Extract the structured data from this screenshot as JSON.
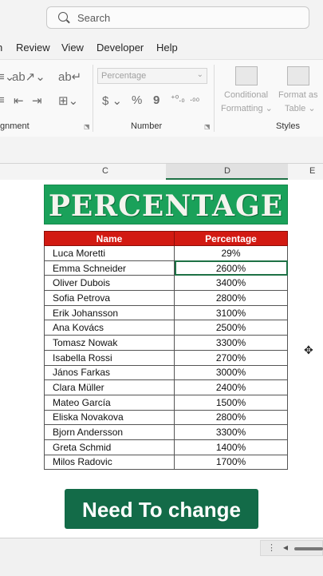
{
  "search": {
    "placeholder": "Search"
  },
  "tabs": [
    {
      "label": "Review"
    },
    {
      "label": "View"
    },
    {
      "label": "Developer"
    },
    {
      "label": "Help"
    }
  ],
  "ribbon": {
    "groups": {
      "alignment": "gnment",
      "number": "Number",
      "styles": "Styles"
    },
    "number_format": "Percentage",
    "conditional": {
      "line1": "Conditional",
      "line2": "Formatting"
    },
    "format_as": {
      "line1": "Format as",
      "line2": "Table"
    }
  },
  "columns": {
    "c": "C",
    "d": "D",
    "e": "E"
  },
  "banner": {
    "title": "PERCENTAGE"
  },
  "table": {
    "headers": [
      "Name",
      "Percentage"
    ],
    "rows": [
      {
        "name": "Luca Moretti",
        "pct": "29%"
      },
      {
        "name": "Emma Schneider",
        "pct": "2600%"
      },
      {
        "name": "Oliver Dubois",
        "pct": "3400%"
      },
      {
        "name": "Sofia Petrova",
        "pct": "2800%"
      },
      {
        "name": "Erik Johansson",
        "pct": "3100%"
      },
      {
        "name": "Ana Kovács",
        "pct": "2500%"
      },
      {
        "name": "Tomasz Nowak",
        "pct": "3300%"
      },
      {
        "name": "Isabella Rossi",
        "pct": "2700%"
      },
      {
        "name": "János Farkas",
        "pct": "3000%"
      },
      {
        "name": "Clara Müller",
        "pct": "2400%"
      },
      {
        "name": "Mateo García",
        "pct": "1500%"
      },
      {
        "name": "Eliska Novakova",
        "pct": "2800%"
      },
      {
        "name": "Bjorn Andersson",
        "pct": "3300%"
      },
      {
        "name": "Greta Schmid",
        "pct": "1400%"
      },
      {
        "name": "Milos Radovic",
        "pct": "1700%"
      }
    ]
  },
  "button": {
    "label": "Need To change"
  },
  "colors": {
    "accent": "#1e7145",
    "banner": "#1aa15a",
    "header_red": "#d21a12",
    "button": "#136b48"
  }
}
